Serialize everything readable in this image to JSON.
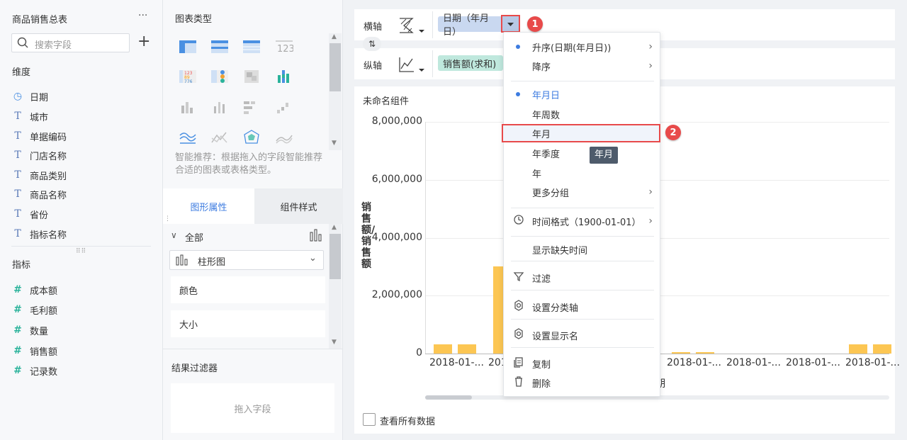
{
  "left": {
    "title": "商品销售总表",
    "more": "···",
    "search_placeholder": "搜索字段",
    "add": "+",
    "dim_header": "维度",
    "dimensions": [
      {
        "label": "日期",
        "icon": "clock-icon"
      },
      {
        "label": "城市",
        "icon": "text-type-icon"
      },
      {
        "label": "单据编码",
        "icon": "text-type-icon"
      },
      {
        "label": "门店名称",
        "icon": "text-type-icon"
      },
      {
        "label": "商品类别",
        "icon": "text-type-icon"
      },
      {
        "label": "商品名称",
        "icon": "text-type-icon"
      },
      {
        "label": "省份",
        "icon": "text-type-icon"
      },
      {
        "label": "指标名称",
        "icon": "text-type-icon"
      }
    ],
    "metric_header": "指标",
    "metrics": [
      {
        "label": "成本额"
      },
      {
        "label": "毛利额"
      },
      {
        "label": "数量"
      },
      {
        "label": "销售额"
      },
      {
        "label": "记录数"
      }
    ]
  },
  "mid": {
    "chart_type_header": "图表类型",
    "smart_hint": "智能推荐：根据拖入的字段智能推荐合适的图表或表格类型。",
    "tab_graph": "图形属性",
    "tab_style": "组件样式",
    "all_label": "全部",
    "bar_select": "柱形图",
    "color_label": "颜色",
    "size_label": "大小",
    "filter_header": "结果过滤器",
    "drop_field": "拖入字段"
  },
  "axes": {
    "x_label": "横轴",
    "y_label": "纵轴",
    "x_pill": "日期（年月日）",
    "y_pill": "销售额(求和)"
  },
  "chart_panel": {
    "title": "未命名组件",
    "ylabel": "销售额/销售额",
    "xlabel_partial": "期",
    "view_all": "查看所有数据"
  },
  "chart_data": {
    "type": "bar",
    "ylabel": "销售额/销售额",
    "ylim": [
      0,
      8000000
    ],
    "yticks": [
      "8,000,000",
      "6,000,000",
      "4,000,000",
      "2,000,000",
      "0"
    ],
    "xtick_labels": [
      "2018-01-...",
      "201",
      "2018-01-...",
      "2018-01-...",
      "2018-01-...",
      "2018-01-..."
    ],
    "bar_pairs_visible": [
      {
        "values": [
          330000,
          330000
        ]
      },
      {
        "values": [
          3000000
        ]
      },
      {
        "values": [
          180000,
          180000
        ]
      },
      {
        "values": [
          40000,
          40000
        ]
      },
      {
        "values": [
          40000,
          40000
        ]
      },
      {
        "values": [
          330000,
          330000
        ]
      }
    ],
    "grid": true
  },
  "menu": {
    "items": [
      {
        "label": "升序(日期(年月日))",
        "selected": true,
        "arrow": true
      },
      {
        "label": "降序",
        "arrow": true
      },
      {
        "label": "年月日",
        "selected": true,
        "active": true
      },
      {
        "label": "年周数"
      },
      {
        "label": "年月",
        "highlight": true
      },
      {
        "label": "年季度"
      },
      {
        "label": "年"
      },
      {
        "label": "更多分组",
        "arrow": true
      },
      {
        "label": "时间格式（1900-01-01）",
        "icon": "clock-icon",
        "arrow": true
      },
      {
        "label": "显示缺失时间"
      },
      {
        "label": "过滤",
        "icon": "filter-icon"
      },
      {
        "label": "设置分类轴",
        "icon": "gear-icon"
      },
      {
        "label": "设置显示名",
        "icon": "gear-icon"
      },
      {
        "label": "复制",
        "icon": "copy-icon"
      },
      {
        "label": "删除",
        "icon": "trash-icon"
      }
    ],
    "tooltip": "年月"
  },
  "badges": [
    "1",
    "2"
  ],
  "colors": {
    "accent": "#3c7be0",
    "bar": "#fcc653",
    "badge": "#e84a4a",
    "x_pill": "#c9d8f0",
    "y_pill": "#bfe8dd"
  }
}
